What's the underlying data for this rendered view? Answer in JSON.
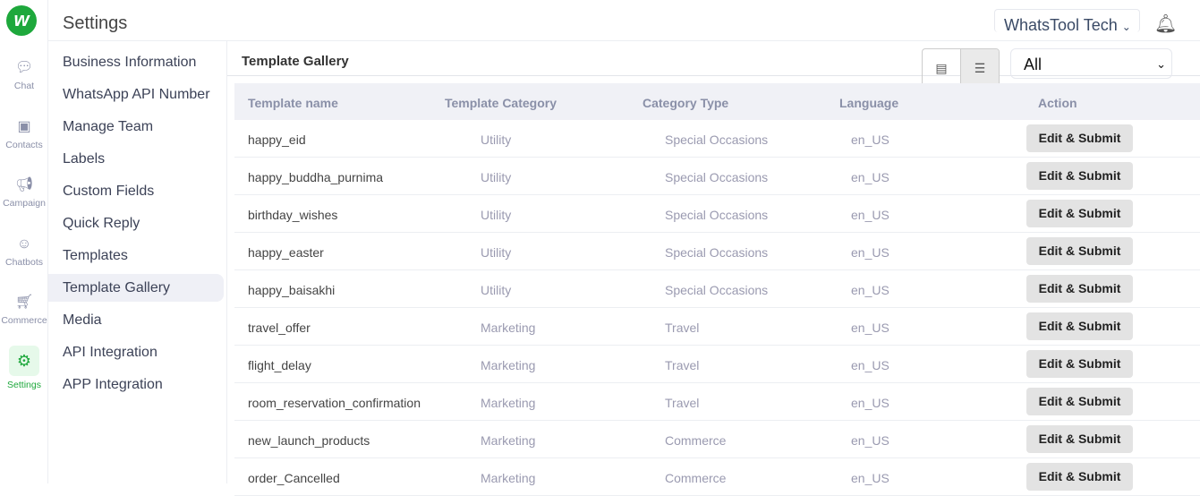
{
  "app": {
    "logo": "w",
    "title": "Settings",
    "org": "WhatsTool Tech",
    "bell_icon": "bell-icon"
  },
  "rail": [
    {
      "label": "Chat",
      "icon": "chat-icon"
    },
    {
      "label": "Contacts",
      "icon": "contacts-icon"
    },
    {
      "label": "Campaign",
      "icon": "megaphone-icon"
    },
    {
      "label": "Chatbots",
      "icon": "bot-icon"
    },
    {
      "label": "Commerce",
      "icon": "cart-icon"
    },
    {
      "label": "Settings",
      "icon": "gear-icon",
      "active": true
    }
  ],
  "nav": [
    "Business Information",
    "WhatsApp API Number",
    "Manage Team",
    "Labels",
    "Custom Fields",
    "Quick Reply",
    "Templates",
    "Template Gallery",
    "Media",
    "API Integration",
    "APP Integration"
  ],
  "nav_active": "Template Gallery",
  "gallery": {
    "title": "Template Gallery",
    "filter": "All",
    "columns": [
      "Template name",
      "Template Category",
      "Category Type",
      "Language",
      "Action"
    ],
    "rows": [
      [
        "happy_eid",
        "Utility",
        "Special Occasions",
        "en_US"
      ],
      [
        "happy_buddha_purnima",
        "Utility",
        "Special Occasions",
        "en_US"
      ],
      [
        "birthday_wishes",
        "Utility",
        "Special Occasions",
        "en_US"
      ],
      [
        "happy_easter",
        "Utility",
        "Special Occasions",
        "en_US"
      ],
      [
        "happy_baisakhi",
        "Utility",
        "Special Occasions",
        "en_US"
      ],
      [
        "travel_offer",
        "Marketing",
        "Travel",
        "en_US"
      ],
      [
        "flight_delay",
        "Marketing",
        "Travel",
        "en_US"
      ],
      [
        "room_reservation_confirmation",
        "Marketing",
        "Travel",
        "en_US"
      ],
      [
        "new_launch_products",
        "Marketing",
        "Commerce",
        "en_US"
      ],
      [
        "order_Cancelled",
        "Marketing",
        "Commerce",
        "en_US"
      ]
    ],
    "action_label": "Edit & Submit"
  },
  "colors": {
    "brand": "#1ea83c"
  }
}
